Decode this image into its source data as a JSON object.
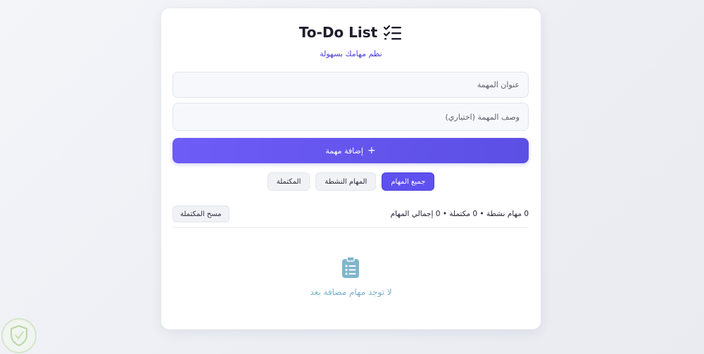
{
  "app": {
    "title": "To-Do List",
    "title_icon": "checklist-icon",
    "subtitle": "نظم مهامك بسهولة"
  },
  "form": {
    "title_placeholder": "عنوان المهمة",
    "description_placeholder": "وصف المهمة (اختياري)",
    "add_button_label": "إضافة مهمة",
    "add_button_icon": "plus-icon"
  },
  "filters": {
    "items": [
      {
        "label": "جميع المهام",
        "active": true
      },
      {
        "label": "المهام النشطة",
        "active": false
      },
      {
        "label": "المكتملة",
        "active": false
      }
    ]
  },
  "summary": {
    "stats_text": "0 مهام نشطة • 0 مكتملة • 0 إجمالي المهام",
    "clear_completed_label": "مسح المكتملة"
  },
  "empty_state": {
    "icon": "clipboard-list-icon",
    "message": "لا توجد مهام مضافة بعد"
  },
  "colors": {
    "accent": "#5f51ef",
    "subtitle": "#4b3fd8",
    "empty_state": "#7ab2cc",
    "background": "#eef0f5"
  }
}
